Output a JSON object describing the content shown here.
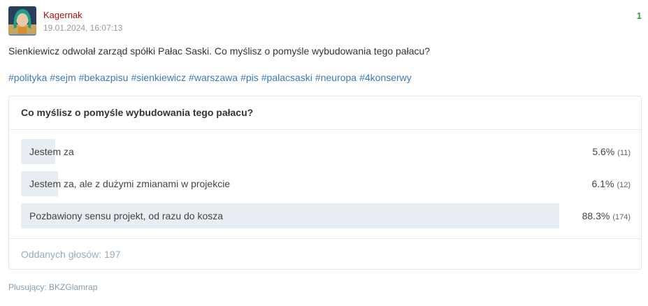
{
  "post": {
    "author": "Kagernak",
    "timestamp": "19.01.2024, 16:07:13",
    "score": "1",
    "content": "Sienkiewicz odwołał zarząd spółki Pałac Saski. Co myślisz o pomyśle wybudowania tego pałacu?",
    "tags": [
      "#polityka",
      "#sejm",
      "#bekazpisu",
      "#sienkiewicz",
      "#warszawa",
      "#pis",
      "#palacsaski",
      "#neuropa",
      "#4konserwy"
    ]
  },
  "poll": {
    "title": "Co myślisz o pomyśle wybudowania tego pałacu?",
    "options": [
      {
        "label": "Jestem za",
        "percent": "5.6%",
        "count": "(11)",
        "fraction": 0.056
      },
      {
        "label": "Jestem za, ale z dużymi zmianami w projekcie",
        "percent": "6.1%",
        "count": "(12)",
        "fraction": 0.061
      },
      {
        "label": "Pozbawiony sensu projekt, od razu do kosza",
        "percent": "88.3%",
        "count": "(174)",
        "fraction": 0.883
      }
    ],
    "total_votes": "Oddanych głosów: 197"
  },
  "plusers": "Plusujący: BKZGlamrap",
  "colors": {
    "author": "#a01212",
    "score": "#2e9e3e",
    "tag": "#3c7ab5",
    "bar": "#e7edf3"
  }
}
